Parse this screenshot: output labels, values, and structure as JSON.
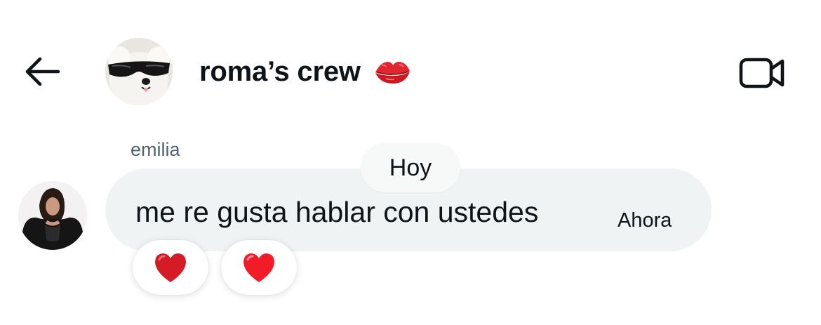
{
  "header": {
    "group_name": "roma’s crew",
    "emoji": "lips-kiss-icon",
    "back_icon": "arrow-left-icon",
    "video_icon": "video-camera-icon"
  },
  "date_separator": "Hoy",
  "message": {
    "sender": "emilia",
    "text": "me re gusta hablar con ustedes",
    "time": "Ahora",
    "reactions": [
      {
        "emoji": "red-heart-icon",
        "color": "#d51b25"
      },
      {
        "emoji": "red-heart-icon",
        "color": "#f21c29"
      }
    ]
  },
  "colors": {
    "bubble": "#eff3f4",
    "text": "#0f1419",
    "secondary_text": "#536471"
  }
}
